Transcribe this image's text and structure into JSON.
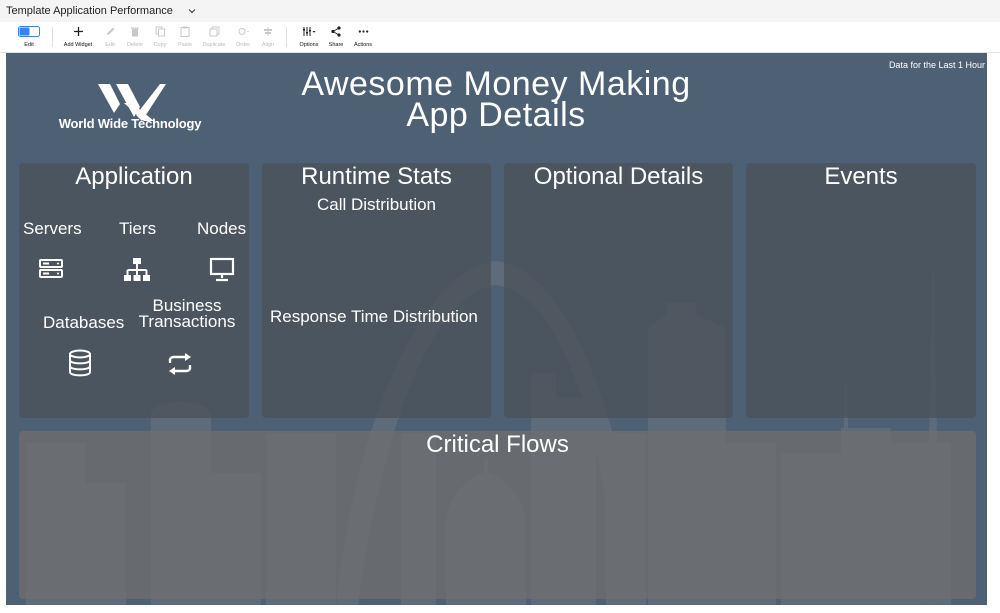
{
  "window": {
    "title": "Template Application Performance"
  },
  "toolbar": {
    "edit": "Edit",
    "add_widget": "Add Widget",
    "edit_widget": "Edit",
    "delete": "Delete",
    "copy": "Copy",
    "paste": "Paste",
    "duplicate": "Duplicate",
    "order": "Order",
    "align": "Align",
    "options": "Options",
    "share": "Share",
    "actions": "Actions"
  },
  "dashboard": {
    "data_range": "Data for the Last 1 Hour",
    "logo_text": "World Wide Technology",
    "title_line1": "Awesome Money Making",
    "title_line2": "App Details"
  },
  "panels": {
    "application": {
      "title": "Application",
      "servers": "Servers",
      "tiers": "Tiers",
      "nodes": "Nodes",
      "databases": "Databases",
      "bt_line1": "Business",
      "bt_line2": "Transactions"
    },
    "runtime": {
      "title": "Runtime Stats",
      "call_distribution": "Call Distribution",
      "response_time": "Response Time Distribution"
    },
    "optional": {
      "title": "Optional Details"
    },
    "events": {
      "title": "Events"
    },
    "critical_flows": {
      "title": "Critical Flows"
    }
  },
  "icons": [
    "chevron-down-icon",
    "toggle-icon",
    "plus-icon",
    "pencil-icon",
    "trash-icon",
    "copy-icon",
    "paste-icon",
    "duplicate-icon",
    "order-icon",
    "align-icon",
    "options-icon",
    "share-icon",
    "more-icon",
    "server-icon",
    "hierarchy-icon",
    "monitor-icon",
    "database-icon",
    "repeat-icon"
  ],
  "colors": {
    "canvas": "#4e6073",
    "panel": "#4a5058",
    "accent": "#3b82f6"
  }
}
